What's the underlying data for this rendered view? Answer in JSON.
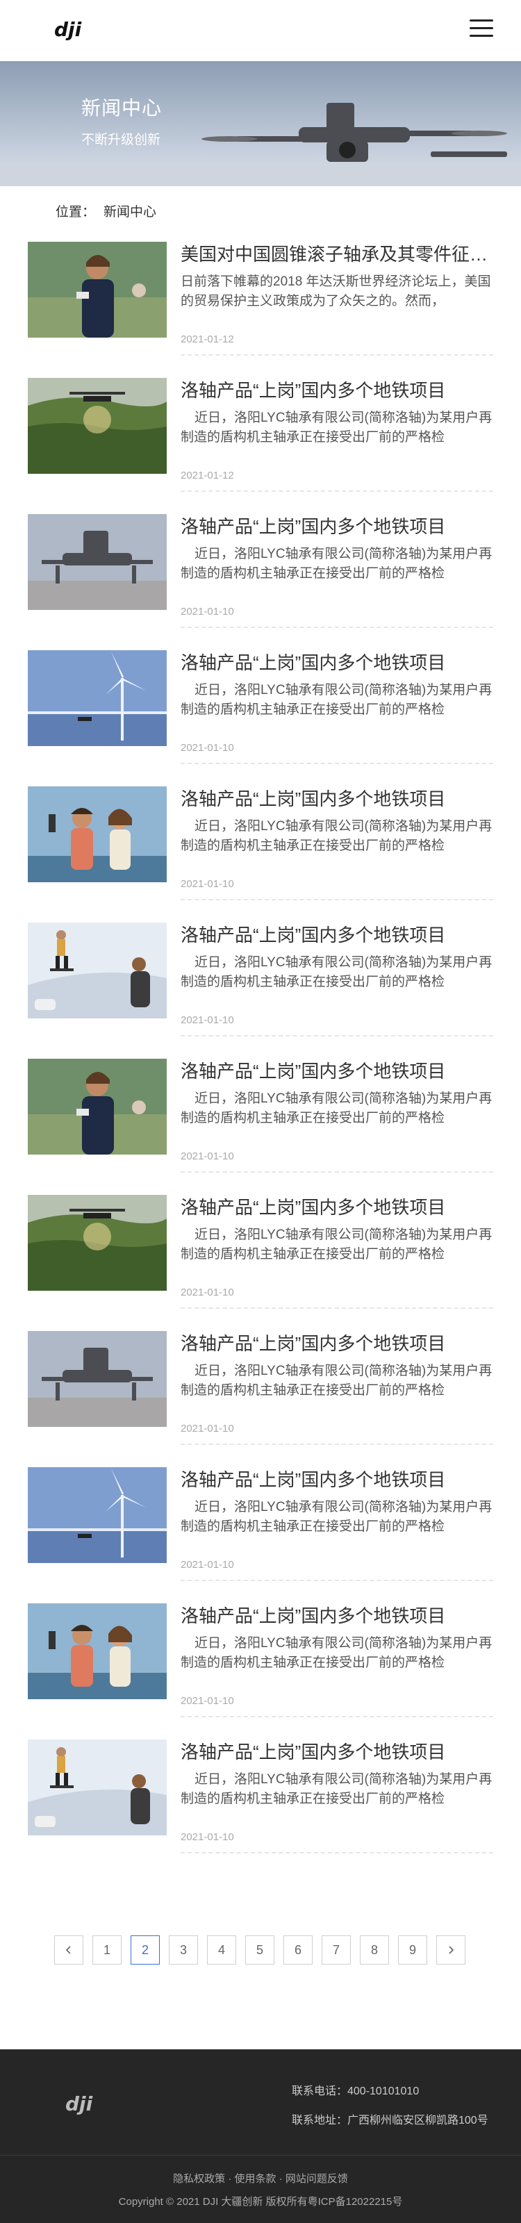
{
  "header": {
    "logo_text": "dji",
    "menu_icon": "hamburger-icon"
  },
  "banner": {
    "title": "新闻中心",
    "subtitle": "不断升级创新"
  },
  "breadcrumb": {
    "label": "位置：",
    "current": "新闻中心"
  },
  "news": [
    {
      "title": "美国对中国圆锥滚子轴承及其零件征收反倾销税",
      "summary": "日前落下帷幕的2018 年达沃斯世界经济论坛上，美国的贸易保护主义政策成为了众矢之的。然而，",
      "date": "2021-01-12",
      "image": "woman-gimbal"
    },
    {
      "title": "洛轴产品“上岗”国内多个地铁项目",
      "summary": "近日，洛阳LYC轴承有限公司(简称洛轴)为某用户再制造的盾构机主轴承正在接受出厂前的严格检",
      "date": "2021-01-12",
      "image": "drone-field"
    },
    {
      "title": "洛轴产品“上岗”国内多个地铁项目",
      "summary": "近日，洛阳LYC轴承有限公司(简称洛轴)为某用户再制造的盾构机主轴承正在接受出厂前的严格检",
      "date": "2021-01-10",
      "image": "drone-ground"
    },
    {
      "title": "洛轴产品“上岗”国内多个地铁项目",
      "summary": "近日，洛阳LYC轴承有限公司(简称洛轴)为某用户再制造的盾构机主轴承正在接受出厂前的严格检",
      "date": "2021-01-10",
      "image": "wind-turbine"
    },
    {
      "title": "洛轴产品“上岗”国内多个地铁项目",
      "summary": "近日，洛阳LYC轴承有限公司(简称洛轴)为某用户再制造的盾构机主轴承正在接受出厂前的严格检",
      "date": "2021-01-10",
      "image": "couple-selfie"
    },
    {
      "title": "洛轴产品“上岗”国内多个地铁项目",
      "summary": "近日，洛阳LYC轴承有限公司(简称洛轴)为某用户再制造的盾构机主轴承正在接受出厂前的严格检",
      "date": "2021-01-10",
      "image": "skater"
    },
    {
      "title": "洛轴产品“上岗”国内多个地铁项目",
      "summary": "近日，洛阳LYC轴承有限公司(简称洛轴)为某用户再制造的盾构机主轴承正在接受出厂前的严格检",
      "date": "2021-01-10",
      "image": "woman-gimbal"
    },
    {
      "title": "洛轴产品“上岗”国内多个地铁项目",
      "summary": "近日，洛阳LYC轴承有限公司(简称洛轴)为某用户再制造的盾构机主轴承正在接受出厂前的严格检",
      "date": "2021-01-10",
      "image": "drone-field"
    },
    {
      "title": "洛轴产品“上岗”国内多个地铁项目",
      "summary": "近日，洛阳LYC轴承有限公司(简称洛轴)为某用户再制造的盾构机主轴承正在接受出厂前的严格检",
      "date": "2021-01-10",
      "image": "drone-ground"
    },
    {
      "title": "洛轴产品“上岗”国内多个地铁项目",
      "summary": "近日，洛阳LYC轴承有限公司(简称洛轴)为某用户再制造的盾构机主轴承正在接受出厂前的严格检",
      "date": "2021-01-10",
      "image": "wind-turbine"
    },
    {
      "title": "洛轴产品“上岗”国内多个地铁项目",
      "summary": "近日，洛阳LYC轴承有限公司(简称洛轴)为某用户再制造的盾构机主轴承正在接受出厂前的严格检",
      "date": "2021-01-10",
      "image": "couple-selfie"
    },
    {
      "title": "洛轴产品“上岗”国内多个地铁项目",
      "summary": "近日，洛阳LYC轴承有限公司(简称洛轴)为某用户再制造的盾构机主轴承正在接受出厂前的严格检",
      "date": "2021-01-10",
      "image": "skater"
    }
  ],
  "pagination": {
    "prev_icon": "chevron-left-icon",
    "next_icon": "chevron-right-icon",
    "pages": [
      "1",
      "2",
      "3",
      "4",
      "5",
      "6",
      "7",
      "8",
      "9"
    ],
    "current": "2"
  },
  "footer": {
    "logo_text": "dji",
    "tel": "联系电话：400-10101010",
    "address": "联系地址：广西柳州临安区柳凯路100号",
    "links": "隐私权政策 · 使用条款 · 网站问题反馈",
    "copyright": "Copyright © 2021 DJI 大疆创新 版权所有粤ICP备12022215号"
  },
  "colors": {
    "accent": "#3b6fd8",
    "footer_bg": "#262626",
    "banner_sky": "#b9c4d4"
  }
}
